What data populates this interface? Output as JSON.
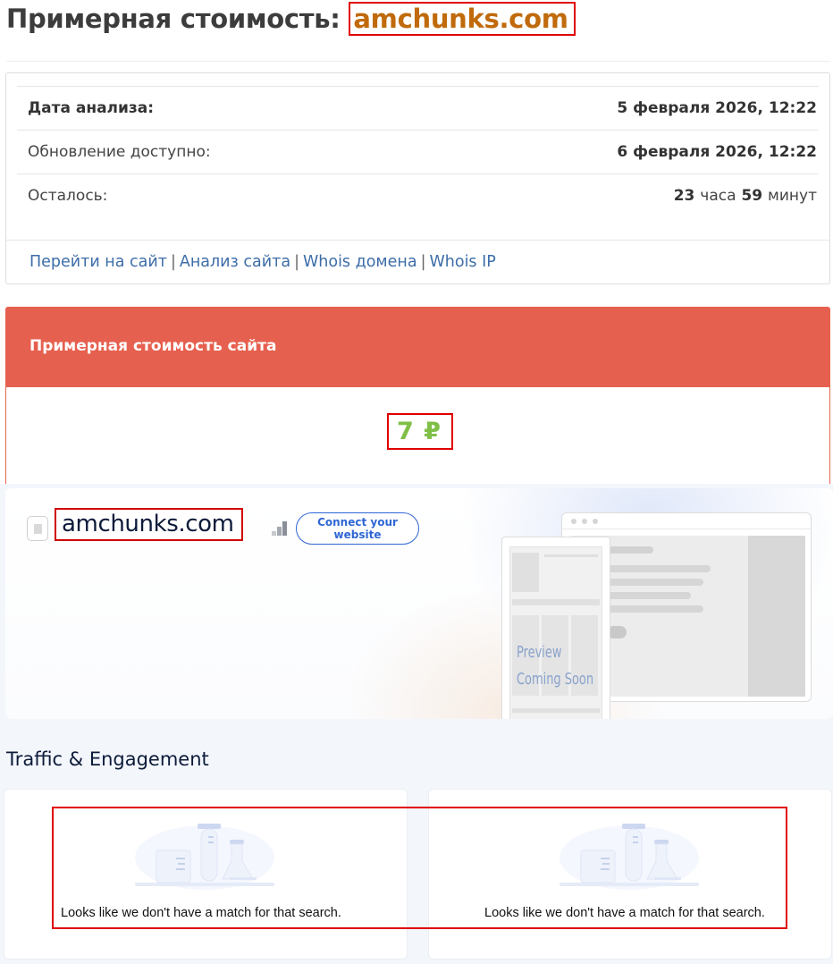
{
  "header": {
    "title_prefix": "Примерная стоимость:",
    "domain": "amchunks.com"
  },
  "info": {
    "rows": [
      {
        "label": "Дата анализа:",
        "value": "5 февраля 2026, 12:22"
      },
      {
        "label": "Обновление доступно:",
        "value": "6 февраля 2026, 12:22"
      },
      {
        "label": "Осталось:",
        "hours": "23",
        "hours_unit": "часа",
        "minutes": "59",
        "minutes_unit": "минут"
      }
    ],
    "links": [
      "Перейти на сайт",
      "Анализ сайта",
      "Whois домена",
      "Whois IP"
    ],
    "separator": "|"
  },
  "cost": {
    "heading": "Примерная стоимость сайта",
    "value": "7 ₽"
  },
  "similarweb": {
    "domain": "amchunks.com",
    "connect_button": "Connect your website",
    "preview_line1": "Preview",
    "preview_line2": "Coming Soon",
    "section_title": "Traffic & Engagement",
    "cards": [
      {
        "message": "Looks like we don't have a match for that search."
      },
      {
        "message": "Looks like we don't have a match for that search."
      }
    ]
  },
  "colors": {
    "accent_red": "#e6604f",
    "domain_orange": "#c06a0b",
    "value_green": "#7fbf46",
    "link_blue": "#3d6da8",
    "sw_blue": "#2f66d5"
  },
  "icons": [
    "file-icon",
    "rank-bars-icon",
    "empty-lab-illustration"
  ]
}
